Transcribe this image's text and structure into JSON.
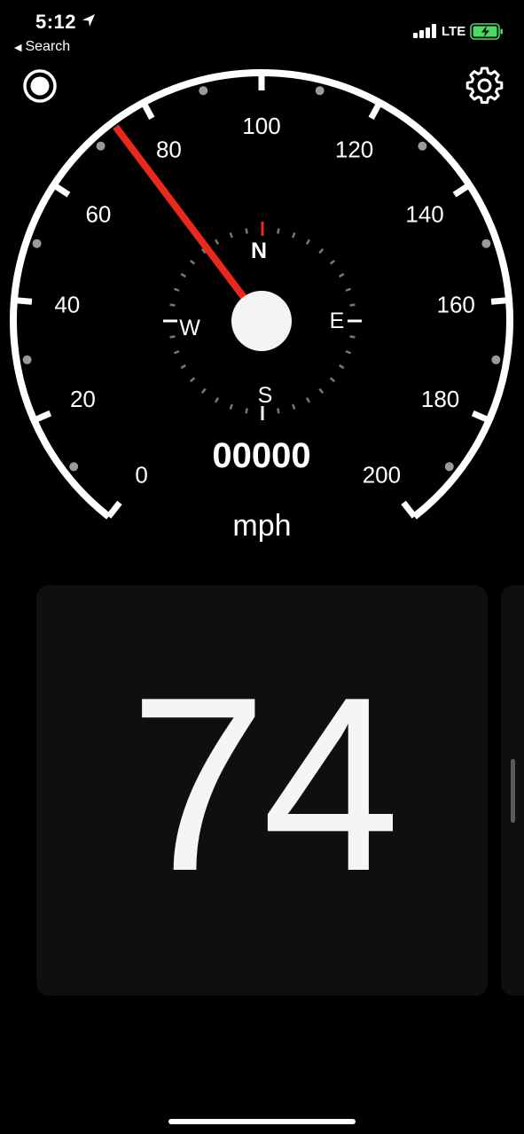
{
  "status_bar": {
    "time": "5:12",
    "back_label": "Search",
    "carrier": "LTE",
    "battery_color": "#4cd964"
  },
  "toolbar": {
    "record_icon": "record-icon",
    "settings_icon": "gear-icon"
  },
  "gauge": {
    "speed_labels": [
      "0",
      "20",
      "40",
      "60",
      "80",
      "100",
      "120",
      "140",
      "160",
      "180",
      "200"
    ],
    "max_speed": 200,
    "current_speed": 74,
    "needle_color": "#e8291c",
    "compass": {
      "north": "N",
      "south": "S",
      "east": "E",
      "west": "W",
      "north_color": "#e8291c"
    },
    "odometer": "00000"
  },
  "unit": "mph",
  "speed_card": {
    "value": "74"
  }
}
